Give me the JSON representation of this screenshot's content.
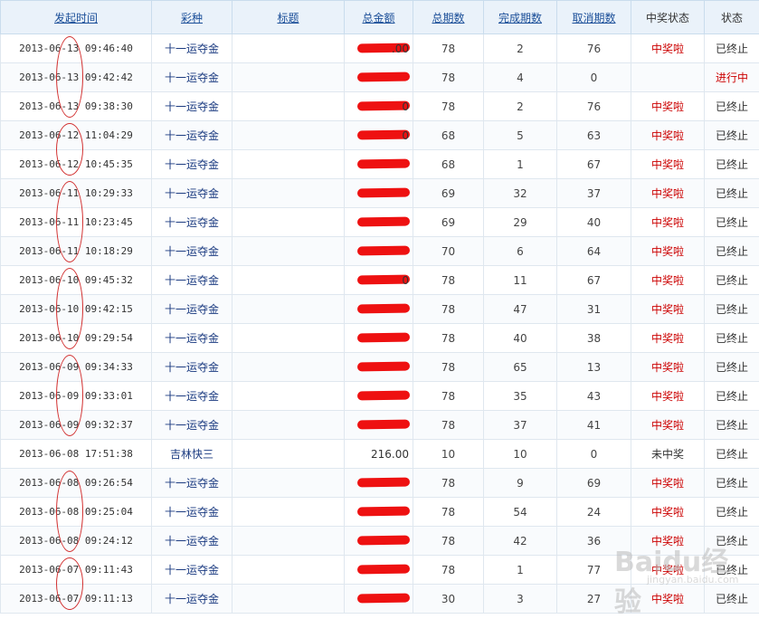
{
  "headers": [
    {
      "label": "发起时间",
      "sortable": true
    },
    {
      "label": "彩种",
      "sortable": true
    },
    {
      "label": "标题",
      "sortable": true
    },
    {
      "label": "总金额",
      "sortable": true
    },
    {
      "label": "总期数",
      "sortable": true
    },
    {
      "label": "完成期数",
      "sortable": true
    },
    {
      "label": "取消期数",
      "sortable": true
    },
    {
      "label": "中奖状态",
      "sortable": false
    },
    {
      "label": "状态",
      "sortable": false
    }
  ],
  "rows": [
    {
      "time": "2013-06-13 09:46:40",
      "lottery": "十一运夺金",
      "title": "",
      "amount": ".00",
      "redacted": true,
      "total": "78",
      "done": "2",
      "cancel": "76",
      "prize": "中奖啦",
      "status": "已终止"
    },
    {
      "time": "2013-06-13 09:42:42",
      "lottery": "十一运夺金",
      "title": "",
      "amount": "",
      "redacted": true,
      "total": "78",
      "done": "4",
      "cancel": "0",
      "prize": "",
      "status": "进行中"
    },
    {
      "time": "2013-06-13 09:38:30",
      "lottery": "十一运夺金",
      "title": "",
      "amount": "0",
      "redacted": true,
      "total": "78",
      "done": "2",
      "cancel": "76",
      "prize": "中奖啦",
      "status": "已终止"
    },
    {
      "time": "2013-06-12 11:04:29",
      "lottery": "十一运夺金",
      "title": "",
      "amount": "0",
      "redacted": true,
      "total": "68",
      "done": "5",
      "cancel": "63",
      "prize": "中奖啦",
      "status": "已终止"
    },
    {
      "time": "2013-06-12 10:45:35",
      "lottery": "十一运夺金",
      "title": "",
      "amount": "",
      "redacted": true,
      "total": "68",
      "done": "1",
      "cancel": "67",
      "prize": "中奖啦",
      "status": "已终止"
    },
    {
      "time": "2013-06-11 10:29:33",
      "lottery": "十一运夺金",
      "title": "",
      "amount": "",
      "redacted": true,
      "total": "69",
      "done": "32",
      "cancel": "37",
      "prize": "中奖啦",
      "status": "已终止"
    },
    {
      "time": "2013-06-11 10:23:45",
      "lottery": "十一运夺金",
      "title": "",
      "amount": "",
      "redacted": true,
      "total": "69",
      "done": "29",
      "cancel": "40",
      "prize": "中奖啦",
      "status": "已终止"
    },
    {
      "time": "2013-06-11 10:18:29",
      "lottery": "十一运夺金",
      "title": "",
      "amount": "",
      "redacted": true,
      "total": "70",
      "done": "6",
      "cancel": "64",
      "prize": "中奖啦",
      "status": "已终止"
    },
    {
      "time": "2013-06-10 09:45:32",
      "lottery": "十一运夺金",
      "title": "",
      "amount": "0",
      "redacted": true,
      "total": "78",
      "done": "11",
      "cancel": "67",
      "prize": "中奖啦",
      "status": "已终止"
    },
    {
      "time": "2013-06-10 09:42:15",
      "lottery": "十一运夺金",
      "title": "",
      "amount": "",
      "redacted": true,
      "total": "78",
      "done": "47",
      "cancel": "31",
      "prize": "中奖啦",
      "status": "已终止"
    },
    {
      "time": "2013-06-10 09:29:54",
      "lottery": "十一运夺金",
      "title": "",
      "amount": "",
      "redacted": true,
      "total": "78",
      "done": "40",
      "cancel": "38",
      "prize": "中奖啦",
      "status": "已终止"
    },
    {
      "time": "2013-06-09 09:34:33",
      "lottery": "十一运夺金",
      "title": "",
      "amount": "",
      "redacted": true,
      "total": "78",
      "done": "65",
      "cancel": "13",
      "prize": "中奖啦",
      "status": "已终止"
    },
    {
      "time": "2013-06-09 09:33:01",
      "lottery": "十一运夺金",
      "title": "",
      "amount": "",
      "redacted": true,
      "total": "78",
      "done": "35",
      "cancel": "43",
      "prize": "中奖啦",
      "status": "已终止"
    },
    {
      "time": "2013-06-09 09:32:37",
      "lottery": "十一运夺金",
      "title": "",
      "amount": "",
      "redacted": true,
      "total": "78",
      "done": "37",
      "cancel": "41",
      "prize": "中奖啦",
      "status": "已终止"
    },
    {
      "time": "2013-06-08 17:51:38",
      "lottery": "吉林快三",
      "title": "",
      "amount": "216.00",
      "redacted": false,
      "total": "10",
      "done": "10",
      "cancel": "0",
      "prize": "未中奖",
      "status": "已终止"
    },
    {
      "time": "2013-06-08 09:26:54",
      "lottery": "十一运夺金",
      "title": "",
      "amount": "",
      "redacted": true,
      "total": "78",
      "done": "9",
      "cancel": "69",
      "prize": "中奖啦",
      "status": "已终止"
    },
    {
      "time": "2013-06-08 09:25:04",
      "lottery": "十一运夺金",
      "title": "",
      "amount": "",
      "redacted": true,
      "total": "78",
      "done": "54",
      "cancel": "24",
      "prize": "中奖啦",
      "status": "已终止"
    },
    {
      "time": "2013-06-08 09:24:12",
      "lottery": "十一运夺金",
      "title": "",
      "amount": "",
      "redacted": true,
      "total": "78",
      "done": "42",
      "cancel": "36",
      "prize": "中奖啦",
      "status": "已终止"
    },
    {
      "time": "2013-06-07 09:11:43",
      "lottery": "十一运夺金",
      "title": "",
      "amount": "",
      "redacted": true,
      "total": "78",
      "done": "1",
      "cancel": "77",
      "prize": "中奖啦",
      "status": "已终止"
    },
    {
      "time": "2013-06-07 09:11:13",
      "lottery": "十一运夺金",
      "title": "",
      "amount": "",
      "redacted": true,
      "total": "30",
      "done": "3",
      "cancel": "27",
      "prize": "中奖啦",
      "status": "已终止"
    }
  ],
  "watermark": {
    "logo": "Baidu经验",
    "url": "jingyan.baidu.com"
  },
  "colors": {
    "header_bg": "#eaf2fa",
    "link": "#1a4e98",
    "win": "#cc0000",
    "redaction": "#ee1111",
    "annotation": "#d23030"
  }
}
